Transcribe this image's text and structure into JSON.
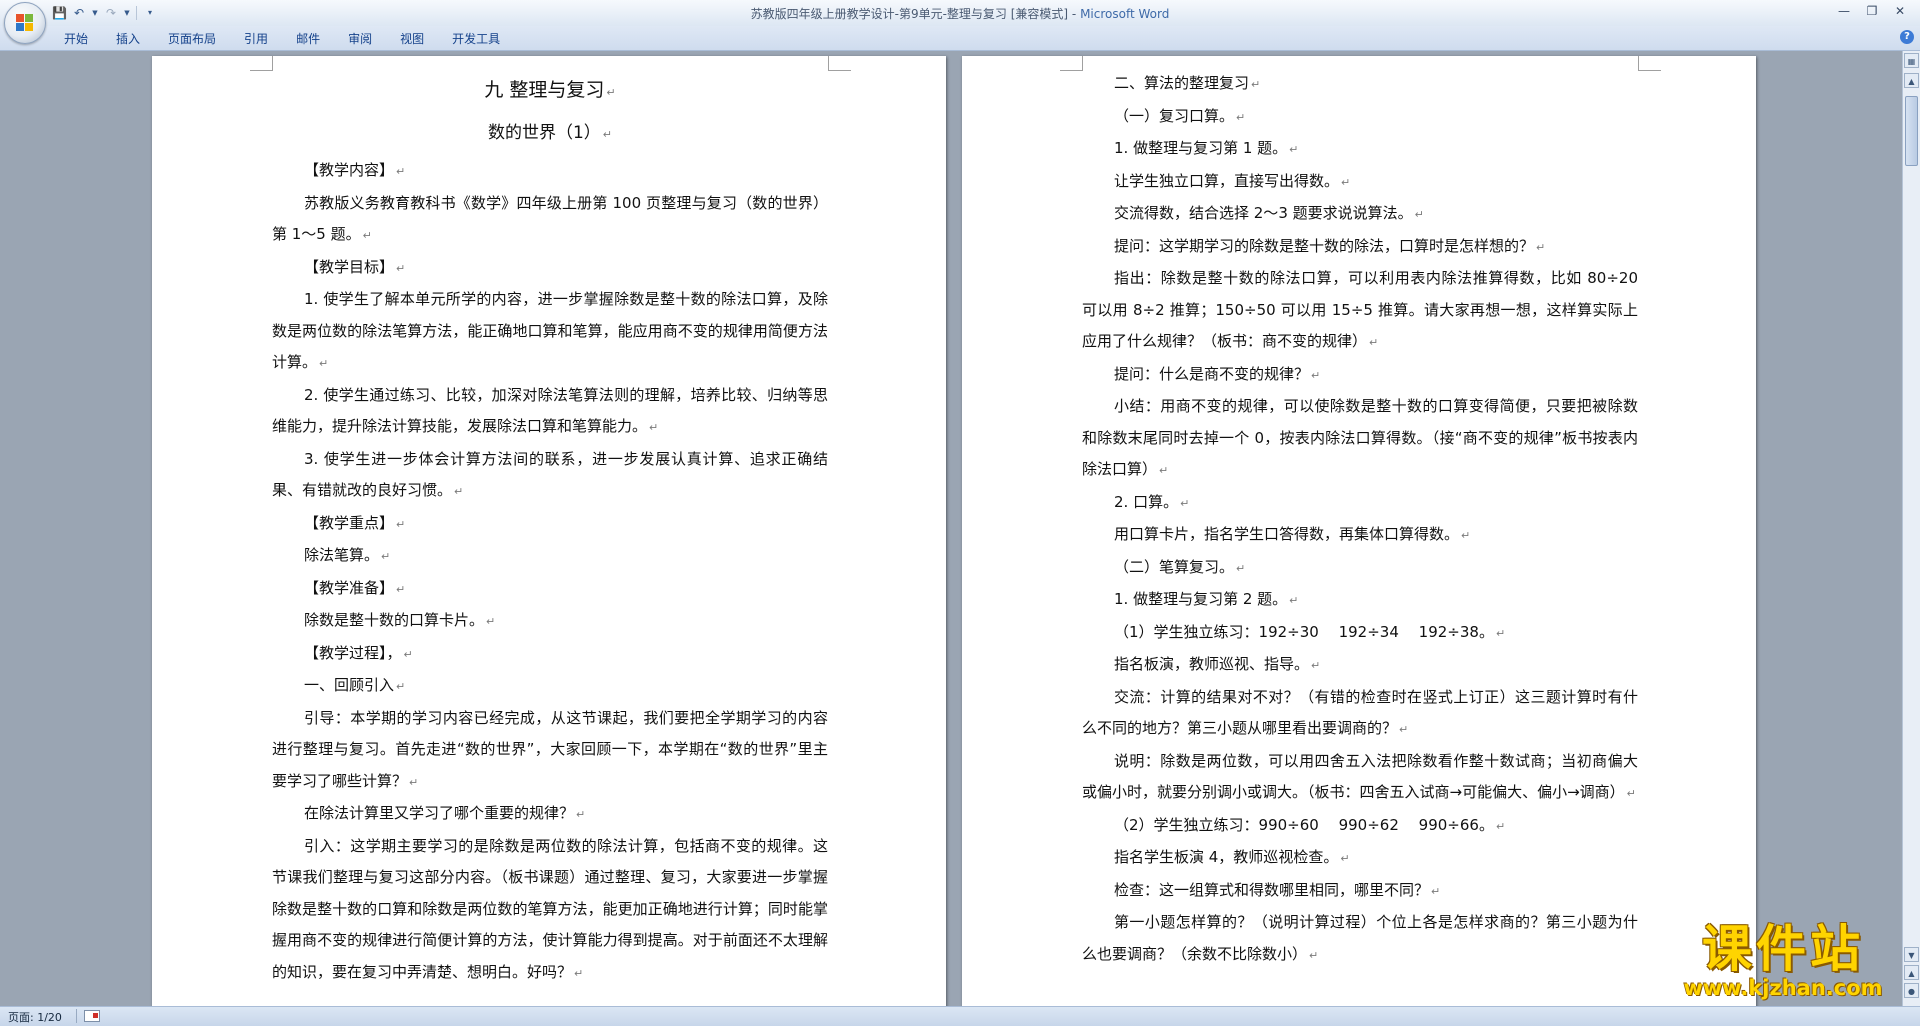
{
  "window": {
    "title_doc": "苏教版四年级上册教学设计-第9单元-整理与复习 [兼容模式]",
    "title_sep": " - ",
    "title_app": "Microsoft Word"
  },
  "qat": {
    "save_icon": "save-icon",
    "undo_icon": "undo-icon",
    "redo_icon": "redo-icon"
  },
  "ribbon": {
    "tabs": [
      "开始",
      "插入",
      "页面布局",
      "引用",
      "邮件",
      "审阅",
      "视图",
      "开发工具"
    ]
  },
  "status": {
    "page": "页面: 1/20"
  },
  "watermark": {
    "main": "课件站",
    "url": "www.kjzhan.com"
  },
  "left_page": [
    "九 整理与复习",
    "数的世界（1）",
    "【教学内容】",
    "苏教版义务教育教科书《数学》四年级上册第 100 页整理与复习（数的世界）第 1～5 题。",
    "【教学目标】",
    "1. 使学生了解本单元所学的内容，进一步掌握除数是整十数的除法口算，及除数是两位数的除法笔算方法，能正确地口算和笔算，能应用商不变的规律用简便方法计算。",
    "2. 使学生通过练习、比较，加深对除法笔算法则的理解，培养比较、归纳等思维能力，提升除法计算技能，发展除法口算和笔算能力。",
    "3. 使学生进一步体会计算方法间的联系，进一步发展认真计算、追求正确结果、有错就改的良好习惯。",
    "【教学重点】",
    "除法笔算。",
    "【教学准备】",
    "除数是整十数的口算卡片。",
    "【教学过程】，",
    "一、回顾引入",
    "引导：本学期的学习内容已经完成，从这节课起，我们要把全学期学习的内容进行整理与复习。首先走进“数的世界”，大家回顾一下，本学期在“数的世界”里主要学习了哪些计算？",
    "在除法计算里又学习了哪个重要的规律？",
    "引入：这学期主要学习的是除数是两位数的除法计算，包括商不变的规律。这节课我们整理与复习这部分内容。（板书课题）通过整理、复习，大家要进一步掌握除数是整十数的口算和除数是两位数的笔算方法，能更加正确地进行计算；同时能掌握用商不变的规律进行简便计算的方法，使计算能力得到提高。对于前面还不太理解的知识，要在复习中弄清楚、想明白。好吗？"
  ],
  "right_page": [
    "二、算法的整理复习",
    "（一）复习口算。",
    "1. 做整理与复习第 1 题。",
    "让学生独立口算，直接写出得数。",
    "交流得数，结合选择 2～3 题要求说说算法。",
    "提问：这学期学习的除数是整十数的除法，口算时是怎样想的？",
    "指出：除数是整十数的除法口算，可以利用表内除法推算得数，比如 80÷20 可以用 8÷2 推算；150÷50 可以用 15÷5 推算。请大家再想一想，这样算实际上应用了什么规律？（板书：商不变的规律）",
    "提问：什么是商不变的规律？",
    "小结：用商不变的规律，可以使除数是整十数的口算变得简便，只要把被除数和除数末尾同时去掉一个 0，按表内除法口算得数。（接“商不变的规律”板书按表内除法口算）",
    "2. 口算。",
    "用口算卡片，指名学生口答得数，再集体口算得数。",
    "（二）笔算复习。",
    "1. 做整理与复习第 2 题。",
    "（1）学生独立练习：192÷30　 192÷34　 192÷38。",
    "指名板演，教师巡视、指导。",
    "交流：计算的结果对不对？（有错的检查时在竖式上订正）这三题计算时有什么不同的地方？第三小题从哪里看出要调商的？",
    "说明：除数是两位数，可以用四舍五入法把除数看作整十数试商；当初商偏大或偏小时，就要分别调小或调大。（板书：四舍五入试商→可能偏大、偏小→调商）",
    "（2）学生独立练习：990÷60　 990÷62　 990÷66。",
    "指名学生板演 4，教师巡视检查。",
    "检查：这一组算式和得数哪里相同，哪里不同？",
    "第一小题怎样算的？（说明计算过程）个位上各是怎样求商的？第三小题为什么也要调商？（余数不比除数小）"
  ]
}
